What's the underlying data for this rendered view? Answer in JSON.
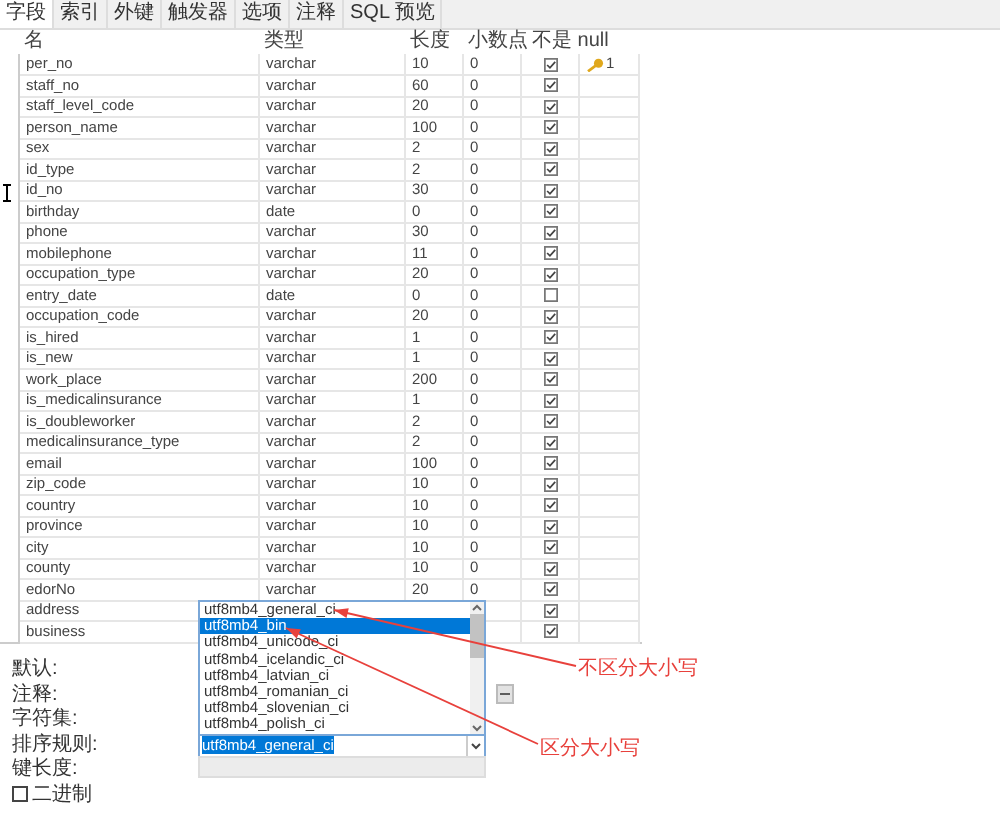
{
  "tabs": [
    {
      "label": "字段",
      "selected": true
    },
    {
      "label": "索引",
      "selected": false
    },
    {
      "label": "外键",
      "selected": false
    },
    {
      "label": "触发器",
      "selected": false
    },
    {
      "label": "选项",
      "selected": false
    },
    {
      "label": "注释",
      "selected": false
    },
    {
      "label": "SQL 预览",
      "selected": false
    }
  ],
  "table": {
    "columns": [
      "名",
      "类型",
      "长度",
      "小数点",
      "不是 null"
    ],
    "rows": [
      {
        "name": "per_no",
        "type": "varchar",
        "length": "10",
        "decimals": "0",
        "not_null": true,
        "key": "1"
      },
      {
        "name": "staff_no",
        "type": "varchar",
        "length": "60",
        "decimals": "0",
        "not_null": true
      },
      {
        "name": "staff_level_code",
        "type": "varchar",
        "length": "20",
        "decimals": "0",
        "not_null": true
      },
      {
        "name": "person_name",
        "type": "varchar",
        "length": "100",
        "decimals": "0",
        "not_null": true
      },
      {
        "name": "sex",
        "type": "varchar",
        "length": "2",
        "decimals": "0",
        "not_null": true
      },
      {
        "name": "id_type",
        "type": "varchar",
        "length": "2",
        "decimals": "0",
        "not_null": true
      },
      {
        "name": "id_no",
        "type": "varchar",
        "length": "30",
        "decimals": "0",
        "not_null": true
      },
      {
        "name": "birthday",
        "type": "date",
        "length": "0",
        "decimals": "0",
        "not_null": true
      },
      {
        "name": "phone",
        "type": "varchar",
        "length": "30",
        "decimals": "0",
        "not_null": true
      },
      {
        "name": "mobilephone",
        "type": "varchar",
        "length": "11",
        "decimals": "0",
        "not_null": true
      },
      {
        "name": "occupation_type",
        "type": "varchar",
        "length": "20",
        "decimals": "0",
        "not_null": true
      },
      {
        "name": "entry_date",
        "type": "date",
        "length": "0",
        "decimals": "0",
        "not_null": false
      },
      {
        "name": "occupation_code",
        "type": "varchar",
        "length": "20",
        "decimals": "0",
        "not_null": true
      },
      {
        "name": "is_hired",
        "type": "varchar",
        "length": "1",
        "decimals": "0",
        "not_null": true
      },
      {
        "name": "is_new",
        "type": "varchar",
        "length": "1",
        "decimals": "0",
        "not_null": true
      },
      {
        "name": "work_place",
        "type": "varchar",
        "length": "200",
        "decimals": "0",
        "not_null": true
      },
      {
        "name": "is_medicalinsurance",
        "type": "varchar",
        "length": "1",
        "decimals": "0",
        "not_null": true
      },
      {
        "name": "is_doubleworker",
        "type": "varchar",
        "length": "2",
        "decimals": "0",
        "not_null": true
      },
      {
        "name": "medicalinsurance_type",
        "type": "varchar",
        "length": "2",
        "decimals": "0",
        "not_null": true
      },
      {
        "name": "email",
        "type": "varchar",
        "length": "100",
        "decimals": "0",
        "not_null": true
      },
      {
        "name": "zip_code",
        "type": "varchar",
        "length": "10",
        "decimals": "0",
        "not_null": true
      },
      {
        "name": "country",
        "type": "varchar",
        "length": "10",
        "decimals": "0",
        "not_null": true
      },
      {
        "name": "province",
        "type": "varchar",
        "length": "10",
        "decimals": "0",
        "not_null": true
      },
      {
        "name": "city",
        "type": "varchar",
        "length": "10",
        "decimals": "0",
        "not_null": true
      },
      {
        "name": "county",
        "type": "varchar",
        "length": "10",
        "decimals": "0",
        "not_null": true
      },
      {
        "name": "edorNo",
        "type": "varchar",
        "length": "20",
        "decimals": "0",
        "not_null": true
      },
      {
        "name": "address",
        "not_null": true
      },
      {
        "name": "business",
        "not_null": true
      }
    ]
  },
  "form": {
    "labels": [
      "默认:",
      "注释:",
      "字符集:",
      "排序规则:",
      "键长度:"
    ],
    "collation": "utf8mb4_general_ci",
    "binary": {
      "label": "二进制",
      "checked": false
    }
  },
  "collation_dropdown": {
    "items": [
      {
        "label": "utf8mb4_general_ci",
        "selected": false
      },
      {
        "label": "utf8mb4_bin",
        "selected": true
      },
      {
        "label": "utf8mb4_unicode_ci",
        "selected": false
      },
      {
        "label": "utf8mb4_icelandic_ci",
        "selected": false
      },
      {
        "label": "utf8mb4_latvian_ci",
        "selected": false
      },
      {
        "label": "utf8mb4_romanian_ci",
        "selected": false
      },
      {
        "label": "utf8mb4_slovenian_ci",
        "selected": false
      },
      {
        "label": "utf8mb4_polish_ci",
        "selected": false
      }
    ]
  },
  "annotations": [
    {
      "text": "不区分大小写"
    },
    {
      "text": "区分大小写"
    }
  ]
}
